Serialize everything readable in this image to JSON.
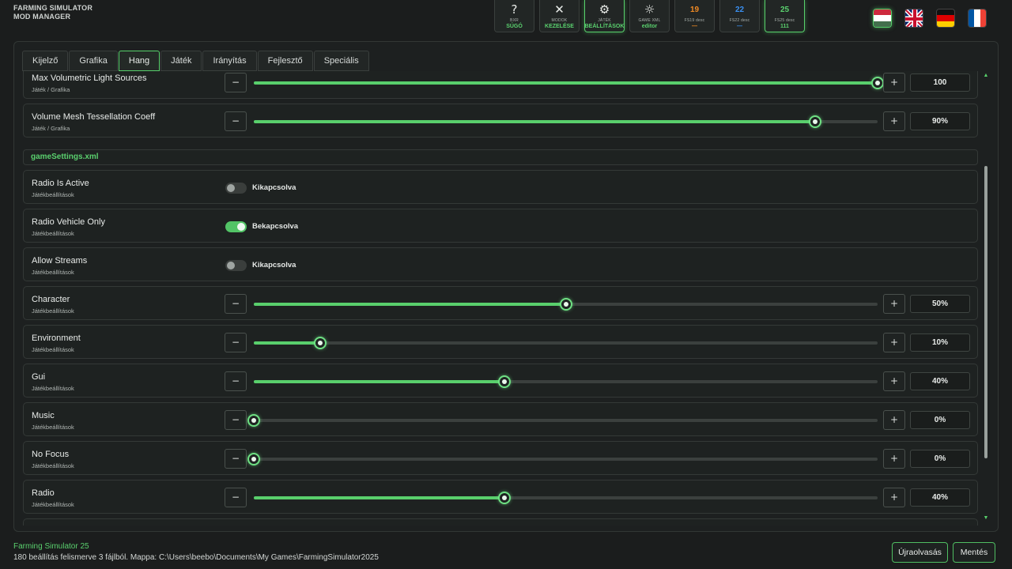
{
  "app": {
    "title_line1": "FARMING SIMULATOR",
    "title_line2": "MOD MANAGER"
  },
  "nav": [
    {
      "icon": "help-icon",
      "glyph": "?",
      "l1": "BXR",
      "l2": "SÚGÓ",
      "active": false
    },
    {
      "icon": "tools-icon",
      "glyph": "✕",
      "l1": "MODOK",
      "l2": "KEZELÉSE",
      "active": false
    },
    {
      "icon": "gear-icon",
      "glyph": "⚙",
      "l1": "JÁTÉK",
      "l2": "BEÁLLÍTÁSOK",
      "active": true
    },
    {
      "icon": "sun-icon",
      "glyph": "☼",
      "l1": "GAME XML",
      "l2": "editor",
      "active": false
    },
    {
      "icon": "fs19-icon",
      "badge": "19",
      "badge_color": "#f08a24",
      "l1": "FS19 desc",
      "l2": "—",
      "l2_color": "#f08a24",
      "active": false
    },
    {
      "icon": "fs22-icon",
      "badge": "22",
      "badge_color": "#3a8ff0",
      "l1": "FS22 desc",
      "l2": "—",
      "l2_color": "#3a8ff0",
      "active": false
    },
    {
      "icon": "fs25-icon",
      "badge": "25",
      "badge_color": "#5ad06e",
      "l1": "FS25 desc",
      "l2": "111",
      "l2_color": "#5ad06e",
      "active": true
    }
  ],
  "flags": [
    {
      "name": "flag-hungarian-icon",
      "active": true
    },
    {
      "name": "flag-english-icon",
      "active": false
    },
    {
      "name": "flag-german-icon",
      "active": false
    },
    {
      "name": "flag-french-icon",
      "active": false
    }
  ],
  "tabs": [
    {
      "label": "Kijelző",
      "active": false
    },
    {
      "label": "Grafika",
      "active": false
    },
    {
      "label": "Hang",
      "active": true
    },
    {
      "label": "Játék",
      "active": false
    },
    {
      "label": "Irányítás",
      "active": false
    },
    {
      "label": "Fejlesztő",
      "active": false
    },
    {
      "label": "Speciális",
      "active": false
    }
  ],
  "slider_rows_top": [
    {
      "name": "Max Volumetric Light Sources",
      "sub": "Játék / Grafika",
      "value": 100,
      "display": "100",
      "fraction": 1.0
    },
    {
      "name": "Volume Mesh Tessellation Coeff",
      "sub": "Játék / Grafika",
      "value": 90,
      "display": "90%",
      "fraction": 0.9
    }
  ],
  "section": {
    "title": "gameSettings.xml"
  },
  "toggle_rows": [
    {
      "name": "Radio Is Active",
      "sub": "Játékbeállítások",
      "on": false,
      "state_label": "Kikapcsolva"
    },
    {
      "name": "Radio Vehicle Only",
      "sub": "Játékbeállítások",
      "on": true,
      "state_label": "Bekapcsolva"
    },
    {
      "name": "Allow Streams",
      "sub": "Játékbeállítások",
      "on": false,
      "state_label": "Kikapcsolva"
    }
  ],
  "slider_rows": [
    {
      "name": "Character",
      "sub": "Játékbeállítások",
      "display": "50%",
      "fraction": 0.5
    },
    {
      "name": "Environment",
      "sub": "Játékbeállítások",
      "display": "10%",
      "fraction": 0.107
    },
    {
      "name": "Gui",
      "sub": "Játékbeállítások",
      "display": "40%",
      "fraction": 0.402
    },
    {
      "name": "Music",
      "sub": "Játékbeállítások",
      "display": "0%",
      "fraction": 0.0
    },
    {
      "name": "No Focus",
      "sub": "Játékbeállítások",
      "display": "0%",
      "fraction": 0.0
    },
    {
      "name": "Radio",
      "sub": "Játékbeállítások",
      "display": "40%",
      "fraction": 0.402
    }
  ],
  "buttons": {
    "minus": "−",
    "plus": "+",
    "scroll_up": "▲",
    "scroll_down": "▼"
  },
  "status": {
    "title": "Farming Simulator 25",
    "text": "180 beállítás felismerve 3 fájlból. Mappa: C:\\Users\\beebo\\Documents\\My Games\\FarmingSimulator2025"
  },
  "footer": {
    "reload": "Újraolvasás",
    "save": "Mentés"
  },
  "colors": {
    "accent": "#5ad06e",
    "background": "#1b1d1d",
    "row_bg": "#1e2221"
  }
}
